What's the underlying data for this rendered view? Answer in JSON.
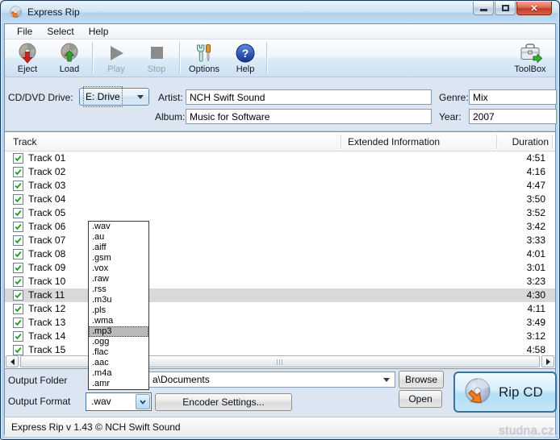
{
  "window": {
    "title": "Express Rip"
  },
  "menu": {
    "items": [
      {
        "label": "File"
      },
      {
        "label": "Select"
      },
      {
        "label": "Help"
      }
    ]
  },
  "toolbar": {
    "buttons": [
      {
        "label": "Eject",
        "enabled": true
      },
      {
        "label": "Load",
        "enabled": true
      },
      {
        "label": "Play",
        "enabled": false
      },
      {
        "label": "Stop",
        "enabled": false
      },
      {
        "label": "Options",
        "enabled": true
      },
      {
        "label": "Help",
        "enabled": true
      }
    ],
    "toolbox": {
      "label": "ToolBox"
    }
  },
  "drive_panel": {
    "drive_label": "CD/DVD Drive:",
    "drive_value": "E: Drive",
    "artist_label": "Artist:",
    "artist_value": "NCH Swift Sound",
    "album_label": "Album:",
    "album_value": "Music for Software",
    "genre_label": "Genre:",
    "genre_value": "Mix",
    "year_label": "Year:",
    "year_value": "2007"
  },
  "tracklist": {
    "columns": [
      "Track",
      "Extended Information",
      "Duration"
    ],
    "selected_index": 10,
    "rows": [
      {
        "label": "Track 01",
        "checked": true,
        "duration": "4:51"
      },
      {
        "label": "Track 02",
        "checked": true,
        "duration": "4:16"
      },
      {
        "label": "Track 03",
        "checked": true,
        "duration": "4:47"
      },
      {
        "label": "Track 04",
        "checked": true,
        "duration": "3:50"
      },
      {
        "label": "Track 05",
        "checked": true,
        "duration": "3:52"
      },
      {
        "label": "Track 06",
        "checked": true,
        "duration": "3:42"
      },
      {
        "label": "Track 07",
        "checked": true,
        "duration": "3:33"
      },
      {
        "label": "Track 08",
        "checked": true,
        "duration": "4:01"
      },
      {
        "label": "Track 09",
        "checked": true,
        "duration": "3:01"
      },
      {
        "label": "Track 10",
        "checked": true,
        "duration": "3:23"
      },
      {
        "label": "Track 11",
        "checked": true,
        "duration": "4:30"
      },
      {
        "label": "Track 12",
        "checked": true,
        "duration": "4:11"
      },
      {
        "label": "Track 13",
        "checked": true,
        "duration": "3:49"
      },
      {
        "label": "Track 14",
        "checked": true,
        "duration": "3:12"
      },
      {
        "label": "Track 15",
        "checked": true,
        "duration": "4:58"
      }
    ]
  },
  "format_dropdown": {
    "items": [
      ".wav",
      ".au",
      ".aiff",
      ".gsm",
      ".vox",
      ".raw",
      ".rss",
      ".m3u",
      ".pls",
      ".wma",
      ".mp3",
      ".ogg",
      ".flac",
      ".aac",
      ".m4a",
      ".amr"
    ],
    "highlighted": ".mp3"
  },
  "output_panel": {
    "folder_label": "Output Folder",
    "folder_value": "a\\Documents",
    "browse_label": "Browse",
    "format_label": "Output Format",
    "format_value": ".wav",
    "encoder_label": "Encoder Settings...",
    "open_label": "Open",
    "rip_label": "Rip CD"
  },
  "statusbar": {
    "text": "Express Rip v 1.43 © NCH Swift Sound"
  },
  "watermark": {
    "text": "studna.cz"
  },
  "colors": {
    "accent_blue": "#39719f",
    "selection_gray": "#d9d9d9",
    "check_green": "#18a018",
    "close_red": "#c23b27",
    "arrow_orange": "#f08020"
  }
}
